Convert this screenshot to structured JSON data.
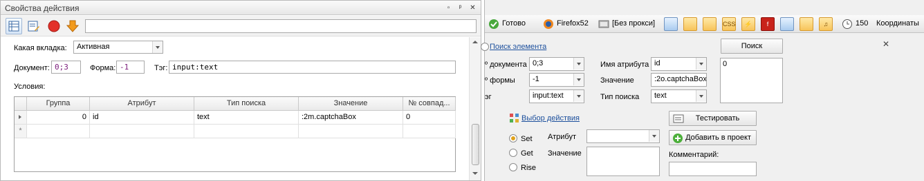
{
  "left_panel": {
    "title": "Свойства действия",
    "window_buttons": [
      "▫",
      "ᵖ",
      "✕"
    ],
    "toolbar_input_value": "",
    "tab_label": "Какая вкладка:",
    "tab_value": "Активная",
    "document_label": "Документ:",
    "document_value": "0;3",
    "form_label": "Форма:",
    "form_value": "-1",
    "tag_label": "Тэг:",
    "tag_value": "input:text",
    "conditions_label": "Условия:",
    "grid": {
      "columns": [
        "Группа",
        "Атрибут",
        "Тип поиска",
        "Значение",
        "№ совпад..."
      ],
      "rows": [
        {
          "group": "0",
          "attribute": "id",
          "search_type": "text",
          "value": ":2m.captchaBox",
          "match_no": "0"
        }
      ],
      "new_row_marker": "*"
    }
  },
  "right_panel": {
    "status": "Готово",
    "browser": "Firefox52",
    "proxy": "[Без прокси]",
    "count": "150",
    "coords_label": "Координаты",
    "find_element_link": "Поиск элемента",
    "doc_label": "º документа",
    "doc_value": "0;3",
    "form_label": "º формы",
    "form_value": "-1",
    "tag_label": "эг",
    "tag_value": "input:text",
    "attr_name_label": "Имя атрибута",
    "attr_name_value": "id",
    "value_label": "Значение",
    "value_value": ":2o.captchaBox",
    "search_type_label": "Тип поиска",
    "search_type_value": "text",
    "search_button": "Поиск",
    "results_list": [
      "0"
    ],
    "close_icon": "✕",
    "select_action_link": "Выбор действия",
    "radio_set": "Set",
    "radio_get": "Get",
    "radio_rise": "Rise",
    "attribute_label": "Атрибут",
    "action_value_label": "Значение",
    "test_button": "Тестировать",
    "add_button": "Добавить в проект",
    "comment_label": "Комментарий:"
  }
}
